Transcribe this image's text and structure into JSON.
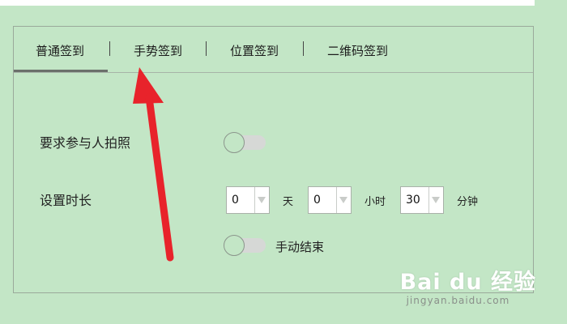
{
  "tabs": [
    {
      "label": "普通签到",
      "active": true
    },
    {
      "label": "手势签到",
      "active": false
    },
    {
      "label": "位置签到",
      "active": false
    },
    {
      "label": "二维码签到",
      "active": false
    }
  ],
  "tab_separator": "|",
  "photo_row": {
    "label": "要求参与人拍照",
    "toggle_on": false
  },
  "duration_row": {
    "label": "设置时长",
    "days": {
      "value": "0",
      "unit": "天"
    },
    "hours": {
      "value": "0",
      "unit": "小时"
    },
    "minutes": {
      "value": "30",
      "unit": "分钟"
    }
  },
  "manual_end": {
    "label": "手动结束",
    "toggle_on": false
  },
  "annotation": {
    "arrow_color": "#e8232b"
  },
  "watermark": {
    "logo_text": "Bai du 经验",
    "url": "jingyan.baidu.com"
  },
  "colors": {
    "background": "#c3e6c6",
    "border": "#9aa99b"
  }
}
